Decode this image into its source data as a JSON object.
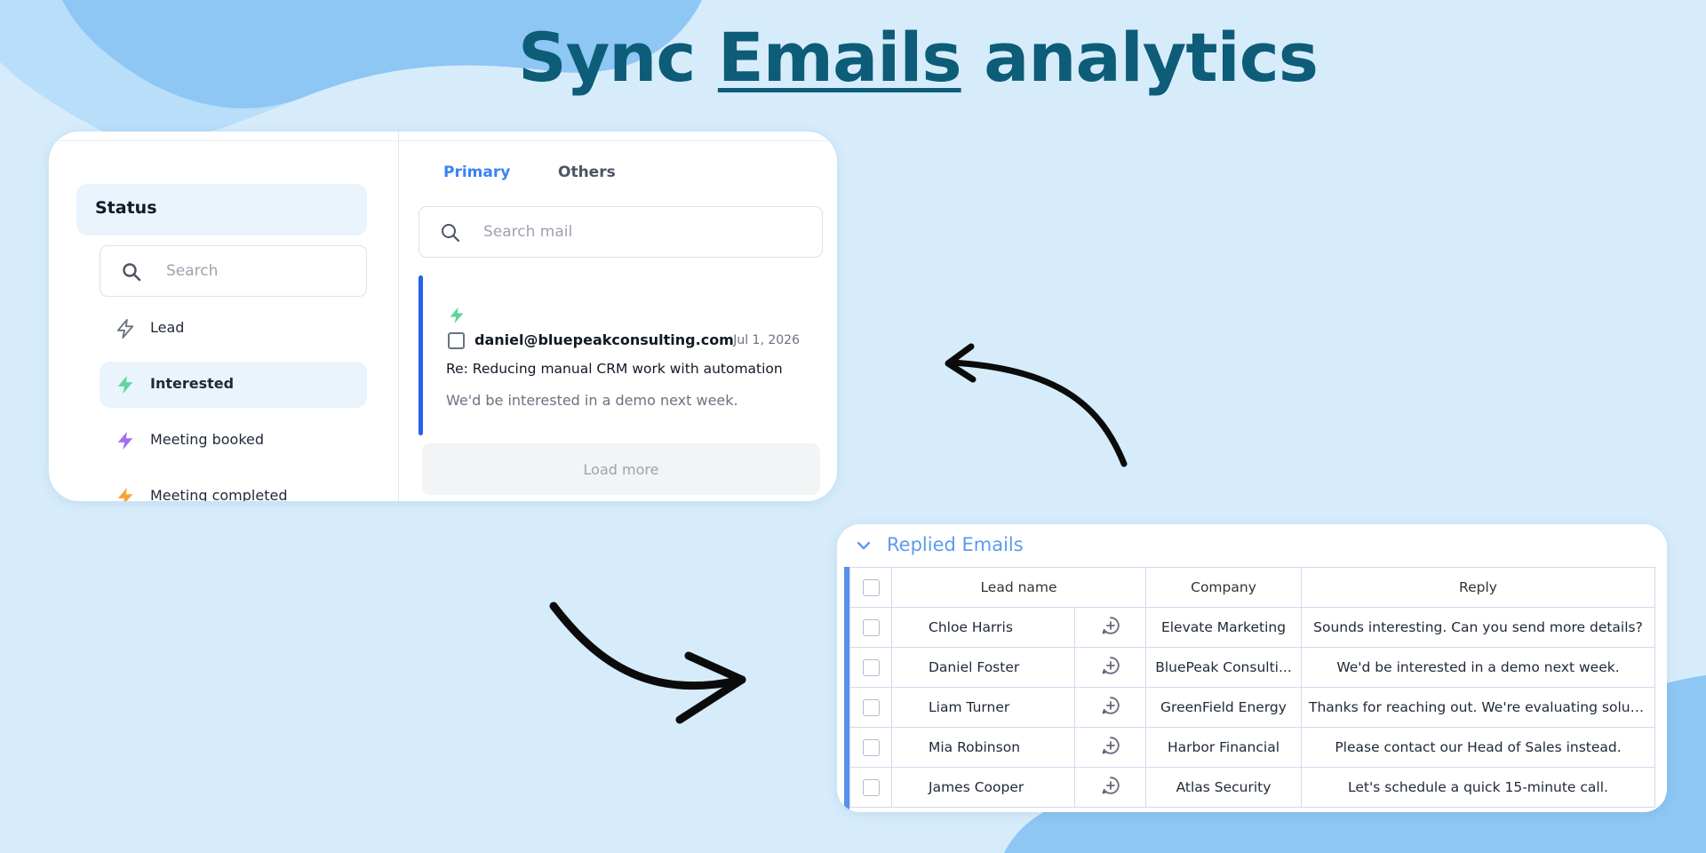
{
  "headline": {
    "word1": "Sync",
    "word2": "Emails",
    "word3": "analytics"
  },
  "colors": {
    "background": "#d6ecfb",
    "headline": "#0d5c78",
    "accent": "#3b82f6",
    "selected_bar": "#2563eb"
  },
  "inbox": {
    "sidebar": {
      "title": "Status",
      "search_placeholder": "Search",
      "items": [
        {
          "label": "Lead",
          "icon": "lightning-outline-icon",
          "color": "#6b7280",
          "active": false
        },
        {
          "label": "Interested",
          "icon": "lightning-icon",
          "color": "#5fd59a",
          "active": true
        },
        {
          "label": "Meeting booked",
          "icon": "lightning-icon",
          "color": "#a66cf0",
          "active": false
        },
        {
          "label": "Meeting completed",
          "icon": "lightning-icon",
          "color": "#f6a531",
          "active": false
        }
      ]
    },
    "tabs": [
      "Primary",
      "Others"
    ],
    "mail_search_placeholder": "Search mail",
    "email": {
      "from": "daniel@bluepeakconsulting.com",
      "date": "Jul 1, 2026",
      "subject": "Re: Reducing manual CRM work with automation",
      "preview": "We'd be interested in a demo next week.",
      "status_icon": "lightning-icon",
      "status_color": "#5fd59a"
    },
    "load_more": "Load more"
  },
  "replied": {
    "title": "Replied Emails",
    "columns": [
      "Lead name",
      "Company",
      "Reply"
    ],
    "rows": [
      {
        "lead": "Chloe Harris",
        "company": "Elevate Marketing",
        "reply": "Sounds interesting. Can you send more details?"
      },
      {
        "lead": "Daniel Foster",
        "company": "BluePeak Consulti...",
        "reply": "We'd be interested in a demo next week."
      },
      {
        "lead": "Liam Turner",
        "company": "GreenField Energy",
        "reply": "Thanks for reaching out. We're evaluating solutio..."
      },
      {
        "lead": "Mia Robinson",
        "company": "Harbor Financial",
        "reply": "Please contact our Head of Sales instead."
      },
      {
        "lead": "James Cooper",
        "company": "Atlas Security",
        "reply": "Let's schedule a quick 15-minute call."
      }
    ]
  }
}
